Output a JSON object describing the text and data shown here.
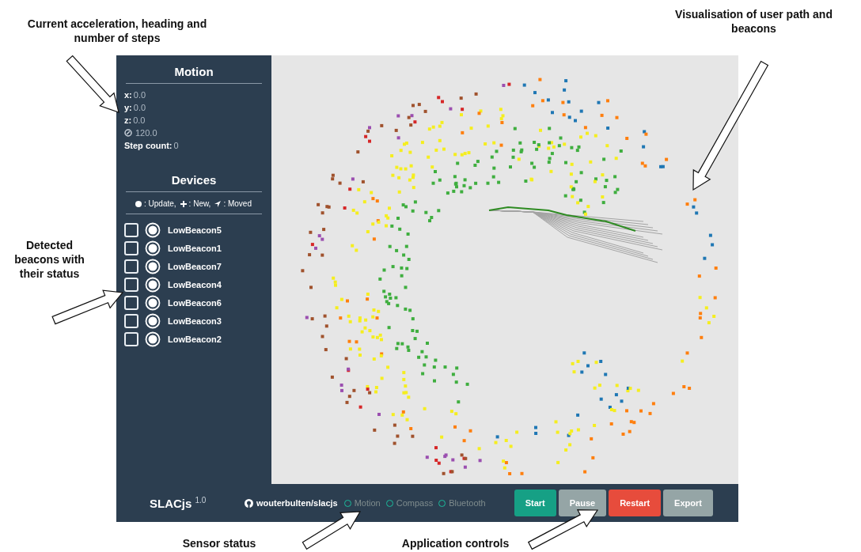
{
  "annotations": [
    {
      "text": "Current acceleration, heading and number of steps"
    },
    {
      "text": "Visualisation of user path and beacons"
    },
    {
      "text": "Detected beacons with their status"
    },
    {
      "text": "Sensor status"
    },
    {
      "text": "Application controls"
    }
  ],
  "sidebar": {
    "motion": {
      "title": "Motion",
      "items": [
        {
          "kind": "axis",
          "label": "x:",
          "value": "0.0"
        },
        {
          "kind": "axis",
          "label": "y:",
          "value": "0.0"
        },
        {
          "kind": "axis",
          "label": "z:",
          "value": "0.0"
        },
        {
          "kind": "heading",
          "value": "120.0"
        },
        {
          "kind": "axis",
          "label": "Step count:",
          "value": "0"
        }
      ]
    },
    "devices": {
      "title": "Devices",
      "legend": [
        {
          "kind": "update",
          "label": ": Update,"
        },
        {
          "kind": "new",
          "label": ": New,"
        },
        {
          "kind": "moved",
          "label": ": Moved"
        }
      ],
      "items": [
        {
          "name": "LowBeacon5",
          "checked": false,
          "kind": "update"
        },
        {
          "name": "LowBeacon1",
          "checked": false,
          "kind": "update"
        },
        {
          "name": "LowBeacon7",
          "checked": false,
          "kind": "update"
        },
        {
          "name": "LowBeacon4",
          "checked": false,
          "kind": "update"
        },
        {
          "name": "LowBeacon6",
          "checked": false,
          "kind": "update"
        },
        {
          "name": "LowBeacon3",
          "checked": false,
          "kind": "update"
        },
        {
          "name": "LowBeacon2",
          "checked": false,
          "kind": "update"
        }
      ]
    }
  },
  "footer": {
    "brand": "SLACjs $^{1.0}$",
    "repo": "wouterbulten/slacjs",
    "sensors": [
      {
        "label": "Motion",
        "on": false
      },
      {
        "label": "Compass",
        "on": false
      },
      {
        "label": "Bluetooth",
        "on": false
      }
    ],
    "buttons": [
      {
        "label": "Start",
        "kind": "primary"
      },
      {
        "label": "Pause",
        "kind": "secondary"
      },
      {
        "label": "Restart",
        "kind": "danger"
      },
      {
        "label": "Export",
        "kind": "secondary"
      }
    ]
  }
}
